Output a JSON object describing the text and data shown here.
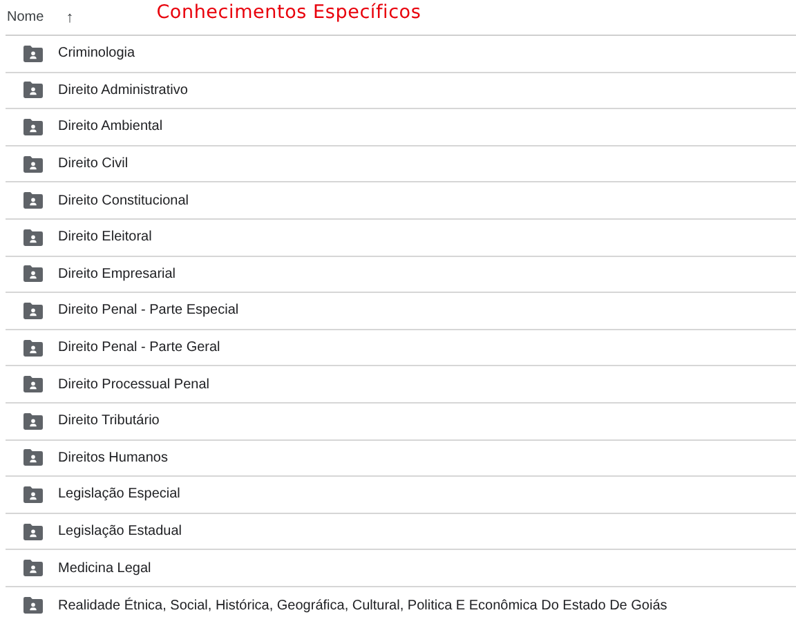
{
  "header": {
    "column": "Nome",
    "sort_icon": "↑",
    "title": "Conhecimentos Específicos"
  },
  "folders": [
    {
      "name": "Criminologia"
    },
    {
      "name": "Direito Administrativo"
    },
    {
      "name": "Direito Ambiental"
    },
    {
      "name": "Direito Civil"
    },
    {
      "name": "Direito Constitucional"
    },
    {
      "name": "Direito Eleitoral"
    },
    {
      "name": "Direito Empresarial"
    },
    {
      "name": "Direito Penal - Parte Especial"
    },
    {
      "name": "Direito Penal - Parte Geral"
    },
    {
      "name": "Direito Processual Penal"
    },
    {
      "name": "Direito Tributário"
    },
    {
      "name": "Direitos Humanos"
    },
    {
      "name": "Legislação Especial"
    },
    {
      "name": "Legislação Estadual"
    },
    {
      "name": "Medicina Legal"
    },
    {
      "name": "Realidade Étnica, Social, Histórica, Geográfica, Cultural, Politica E Econômica Do Estado De Goiás"
    }
  ]
}
